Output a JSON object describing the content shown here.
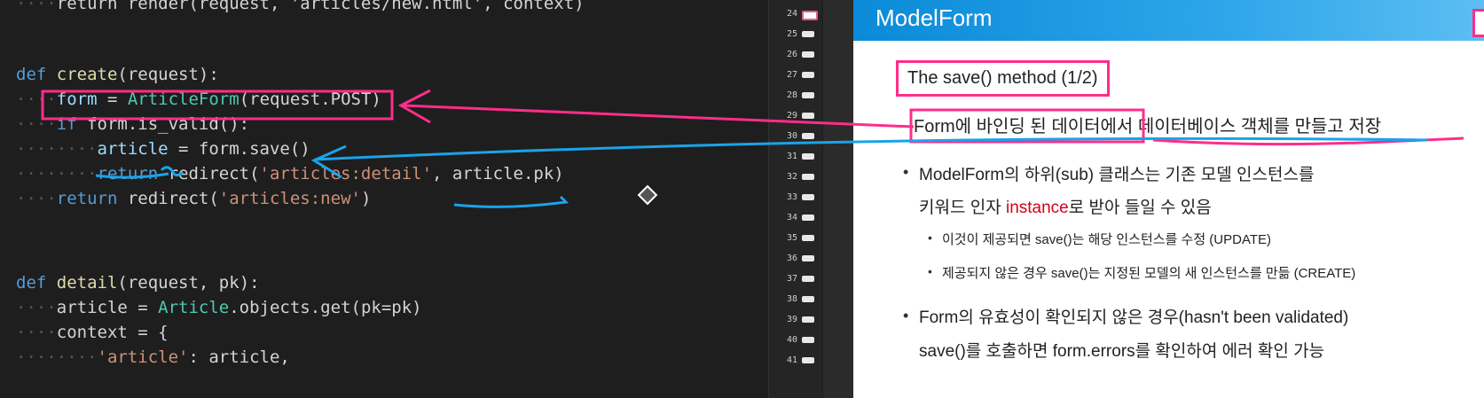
{
  "editor": {
    "lines": [
      {
        "kind": "blank"
      },
      {
        "kind": "def",
        "name": "create",
        "params": "(request):"
      },
      {
        "kind": "form"
      },
      {
        "kind": "if"
      },
      {
        "kind": "article"
      },
      {
        "kind": "return1"
      },
      {
        "kind": "return2"
      },
      {
        "kind": "blank"
      },
      {
        "kind": "def",
        "name": "detail",
        "params": "(request, pk):"
      }
    ],
    "tokens": {
      "def": "def",
      "create": "create",
      "create_params": "(request):",
      "form_var": "form",
      "eq": " = ",
      "article_form": "ArticleForm",
      "request_post": "(request.POST)",
      "if_kw": "if",
      "is_valid": " form.is_valid():",
      "article_var": "article",
      "form_save": "form.save()",
      "return_kw": "return",
      "redirect": " redirect(",
      "detail_str": "'articles:detail'",
      "article_pk": ", article.pk)",
      "new_str": "'articles:new'",
      "close_paren": ")",
      "detail": "detail",
      "detail_params": "(request, pk):",
      "article_eq": "article = ",
      "article_cls": "Article",
      "objects_get": ".objects.get(pk=pk)",
      "context": "context = {",
      "article_key": "'article'",
      "article_val": ": article,",
      "top_partial": "return render(request, 'articles/new.html', context)"
    }
  },
  "gutter": {
    "line_numbers": [
      "24",
      "25",
      "26",
      "27",
      "28",
      "29",
      "30",
      "31",
      "32",
      "33",
      "34",
      "35",
      "36",
      "37",
      "38",
      "39",
      "40",
      "41"
    ]
  },
  "slide": {
    "title": "ModelForm",
    "subtitle": "The save() method (1/2)",
    "headline": "Form에 바인딩 된 데이터에서 데이터베이스 객체를 만들고 저장",
    "bullet1_line1": "ModelForm의 하위(sub) 클래스는 기존 모델 인스턴스를",
    "bullet1_line2_pre": "키워드 인자 ",
    "bullet1_line2_kw": "instance",
    "bullet1_line2_post": "로 받아 들일 수 있음",
    "sub1": "이것이 제공되면 save()는 해당 인스턴스를 수정 (UPDATE)",
    "sub2": "제공되지 않은 경우 save()는 지정된 모델의 새 인스턴스를 만듦 (CREATE)",
    "bullet2_line1": "Form의 유효성이 확인되지 않은 경우(hasn't been validated)",
    "bullet2_line2": "save()를 호출하면 form.errors를 확인하여 에러 확인 가능",
    "bullet_symbol": "•"
  },
  "colors": {
    "annotation_pink": "#ff2d8a",
    "annotation_blue": "#1aa3e8",
    "slide_header": "#1a9be6",
    "instance_red": "#d0021b"
  }
}
